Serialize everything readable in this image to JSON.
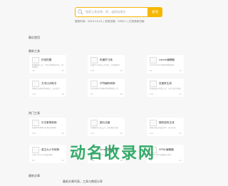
{
  "search": {
    "placeholder": "搜索工具名称、ID、或网站地址",
    "button": "查询"
  },
  "meta": {
    "line": "更新时间：2023-10-01 | 收录总数：5000+ | 已收录和拉取"
  },
  "sections": {
    "recent": "最近使用",
    "latest": "最新工具",
    "hot": "热门工具",
    "recommend": "最新文章"
  },
  "latest_cards": [
    {
      "title": "在线抓图",
      "desc": "在线抓图工具，支持多种格式导出，简单好用",
      "views": "98",
      "likes": "45"
    },
    {
      "title": "机器学习库",
      "desc": "机器学习常用工具合集，可在线运行",
      "views": "105",
      "likes": "38"
    },
    {
      "title": "Lorem编辑器",
      "desc": "LoremIpsum在线生成编辑器",
      "views": "88",
      "likes": "42"
    },
    {
      "title": "文本比对助手",
      "desc": "快速比对两段文本差异，高亮显示",
      "views": "112",
      "likes": "50"
    },
    {
      "title": "字符编码转换",
      "desc": "支持多种字符编码的在线转换工具",
      "views": "95",
      "likes": "36"
    },
    {
      "title": "进度条生成",
      "desc": "在线进度条生成工具，可以自定义颜色",
      "views": "101",
      "likes": "47"
    }
  ],
  "hot_cards": [
    {
      "title": "中文繁简转换",
      "desc": "在线中文繁体与简体互相转换",
      "views": "120",
      "likes": "60"
    },
    {
      "title": "图片压缩",
      "desc": "在线图片压缩工具，支持批量压缩",
      "views": "132",
      "likes": "58"
    },
    {
      "title": "随机密码生成",
      "desc": "随机生成高强度密码，安全可靠",
      "views": "110",
      "likes": "52"
    },
    {
      "title": "英文大小写转换",
      "desc": "英文字母大小写批量转换",
      "views": "99",
      "likes": "44"
    },
    {
      "title": "Emoji表情大全",
      "desc": "常用Emoji表情一键复制",
      "views": "104",
      "likes": "49"
    },
    {
      "title": "HTML编辑器",
      "desc": "在线HTML代码编辑与预览",
      "views": "97",
      "likes": "41"
    }
  ],
  "watermark": "动名收录网",
  "bottom_line": "最新文章列表，工具与教程分享"
}
